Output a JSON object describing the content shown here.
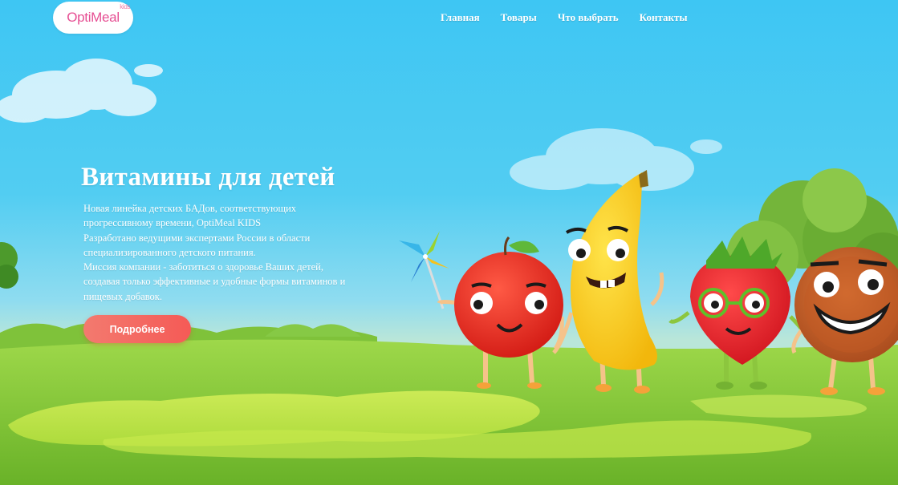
{
  "header": {
    "logo": {
      "name": "OptiMeal",
      "tag": "kids"
    },
    "nav": [
      {
        "label": "Главная"
      },
      {
        "label": "Товары"
      },
      {
        "label": "Что выбрать"
      },
      {
        "label": "Контакты"
      }
    ]
  },
  "hero": {
    "title": "Витамины для детей",
    "lines": [
      "Новая линейка детских БАДов, соответствующих",
      "прогрессивному времени, OptiMeal KIDS",
      "Разработано ведущими экспертами России в области",
      "специализированного детского питания.",
      "Миссия компании - заботиться о здоровье Ваших детей,",
      "создавая только эффективные и удобные формы витаминов и",
      "пищевых добавок."
    ],
    "button_label": "Подробнее"
  },
  "colors": {
    "sky": "#3ec6f3",
    "grass": "#8cc63e",
    "accent_button": "#f55a56",
    "logo_pink": "#e64f93"
  },
  "characters": [
    "apple",
    "banana",
    "strawberry",
    "cookie"
  ]
}
